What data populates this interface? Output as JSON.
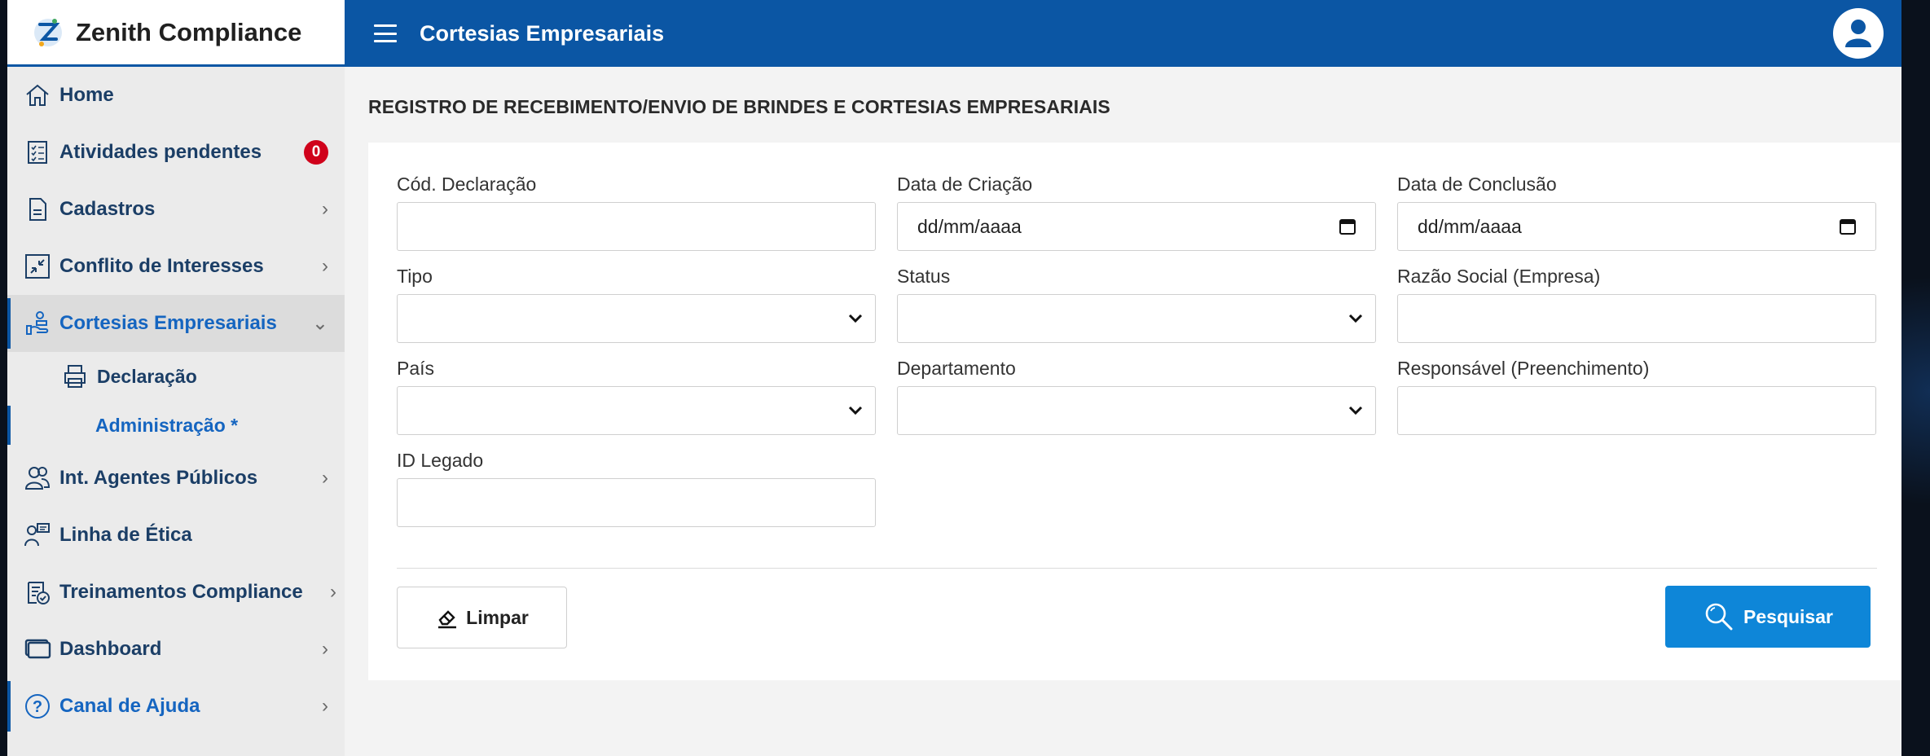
{
  "brand": {
    "name": "Zenith Compliance"
  },
  "topbar": {
    "title": "Cortesias Empresariais"
  },
  "sidebar": {
    "items": [
      {
        "label": "Home",
        "icon": "home-icon"
      },
      {
        "label": "Atividades pendentes",
        "icon": "checklist-icon",
        "badge": "0"
      },
      {
        "label": "Cadastros",
        "icon": "document-icon",
        "chevron": "›"
      },
      {
        "label": "Conflito de Interesses",
        "icon": "arrows-in-icon",
        "chevron": "›"
      },
      {
        "label": "Cortesias Empresariais",
        "icon": "gift-hand-icon",
        "chevron": "⌄"
      },
      {
        "label": "Int. Agentes Públicos",
        "icon": "people-icon",
        "chevron": "›"
      },
      {
        "label": "Linha de Ética",
        "icon": "speaker-icon"
      },
      {
        "label": "Treinamentos Compliance",
        "icon": "clipboard-check-icon",
        "chevron": "›"
      },
      {
        "label": "Dashboard",
        "icon": "monitor-icon",
        "chevron": "›"
      },
      {
        "label": "Canal de Ajuda",
        "icon": "help-icon",
        "chevron": "›"
      }
    ],
    "subitems": [
      {
        "label": "Declaração",
        "icon": "printer-icon"
      },
      {
        "label": "Administração *"
      }
    ]
  },
  "main": {
    "title": "REGISTRO DE RECEBIMENTO/ENVIO DE BRINDES E CORTESIAS EMPRESARIAIS",
    "fields": {
      "cod_declaracao": {
        "label": "Cód. Declaração",
        "value": ""
      },
      "data_criacao": {
        "label": "Data de Criação",
        "placeholder": "dd/mm/aaaa"
      },
      "data_conclusao": {
        "label": "Data de Conclusão",
        "placeholder": "dd/mm/aaaa"
      },
      "tipo": {
        "label": "Tipo",
        "value": ""
      },
      "status": {
        "label": "Status",
        "value": ""
      },
      "razao_social": {
        "label": "Razão Social (Empresa)",
        "value": ""
      },
      "pais": {
        "label": "País",
        "value": ""
      },
      "departamento": {
        "label": "Departamento",
        "value": ""
      },
      "responsavel": {
        "label": "Responsável (Preenchimento)",
        "value": ""
      },
      "id_legado": {
        "label": "ID Legado",
        "value": ""
      }
    },
    "buttons": {
      "clear": "Limpar",
      "search": "Pesquisar"
    }
  },
  "colors": {
    "primary": "#0b56a4",
    "search_button": "#0e86d8",
    "badge": "#d0021b",
    "active_text": "#1565c0"
  }
}
